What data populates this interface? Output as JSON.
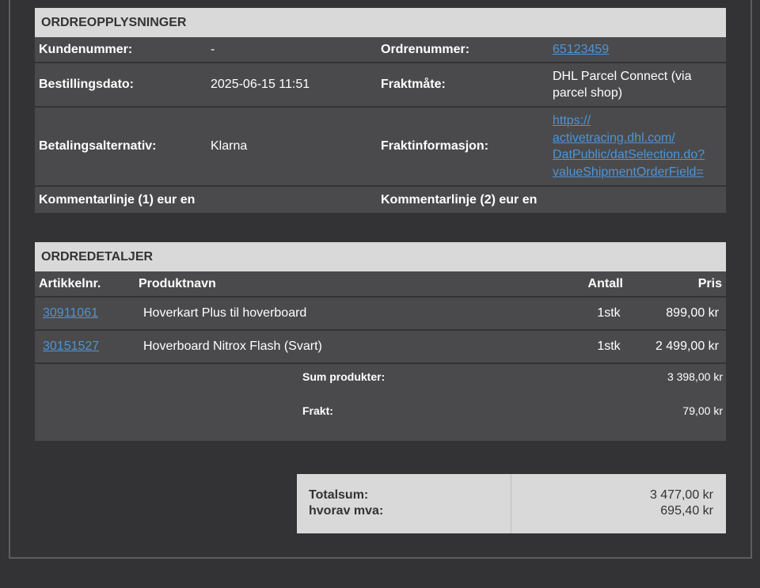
{
  "order_info": {
    "header": "ORDREOPPLYSNINGER",
    "rows": [
      {
        "label1": "Kundenummer:",
        "value1": "-",
        "label2": "Ordrenummer:",
        "value2": "65123459"
      },
      {
        "label1": "Bestillingsdato:",
        "value1": "2025-06-15 11:51",
        "label2": "Fraktmåte:",
        "value2": "DHL Parcel Connect (via parcel shop)"
      },
      {
        "label1": "Betalingsalternativ:",
        "value1": "Klarna",
        "label2": "Fraktinformasjon:",
        "value2_lines": [
          "https://",
          "activetracing.dhl.com/",
          "DatPublic/datSelection.do?",
          "valueShipmentOrderField="
        ]
      },
      {
        "label1": "Kommentarlinje (1) eur en",
        "label2": "Kommentarlinje (2) eur en"
      }
    ]
  },
  "order_details": {
    "header": "ORDREDETALJER",
    "columns": {
      "article": "Artikkelnr.",
      "product": "Produktnavn",
      "qty": "Antall",
      "price": "Pris"
    },
    "items": [
      {
        "article": "30911061",
        "product": "Hoverkart Plus til hoverboard",
        "qty": "1stk",
        "price": "899,00 kr"
      },
      {
        "article": "30151527",
        "product": "Hoverboard Nitrox Flash (Svart)",
        "qty": "1stk",
        "price": "2 499,00 kr"
      }
    ],
    "sum_products_label": "Sum produkter:",
    "sum_products_value": "3 398,00 kr",
    "shipping_label": "Frakt:",
    "shipping_value": "79,00 kr"
  },
  "totals": {
    "total_label": "Totalsum:",
    "total_value": "3 477,00 kr",
    "vat_label": "hvorav mva:",
    "vat_value": "695,40 kr"
  },
  "colors": {
    "background": "#333335",
    "row_bg": "#4a4a4c",
    "header_bg": "#d9d9d9",
    "link": "#4f94d4"
  }
}
